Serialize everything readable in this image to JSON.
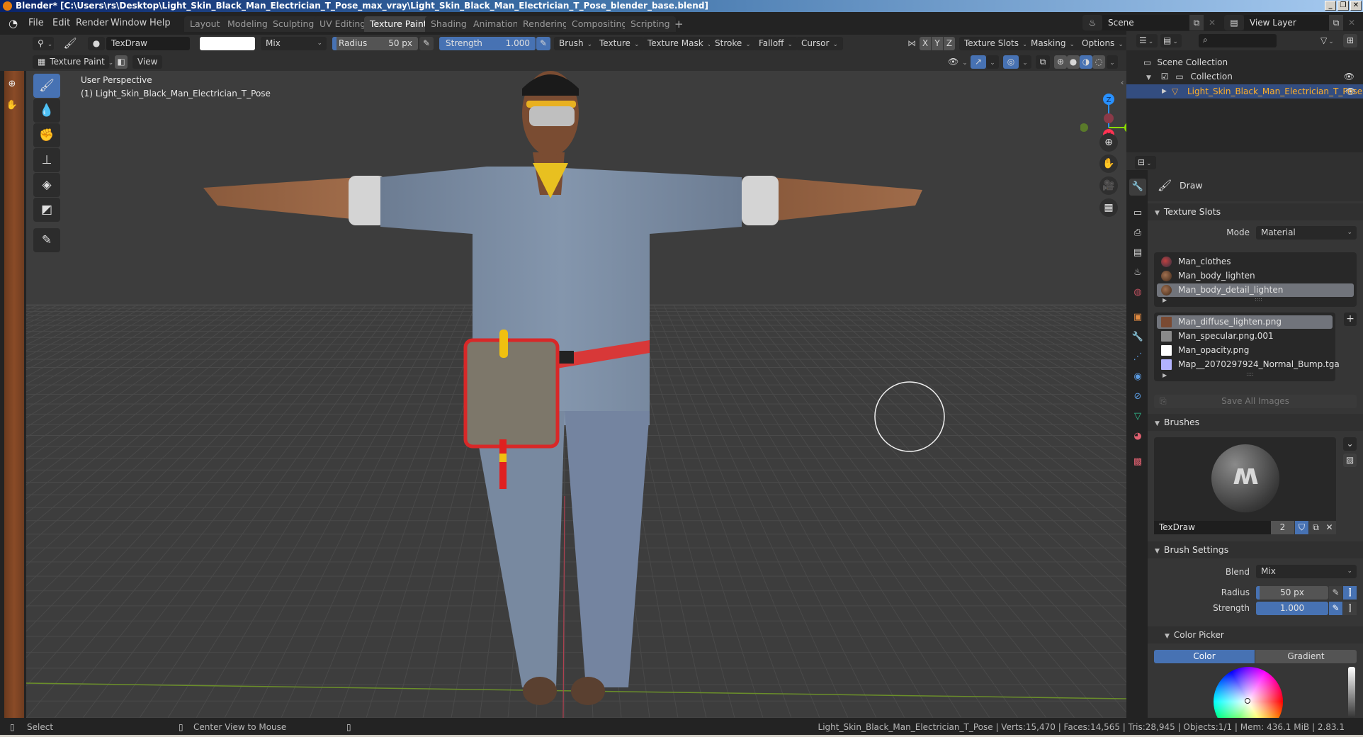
{
  "window": {
    "title": "Blender* [C:\\Users\\rs\\Desktop\\Light_Skin_Black_Man_Electrician_T_Pose_max_vray\\Light_Skin_Black_Man_Electrician_T_Pose_blender_base.blend]",
    "controls": [
      "_",
      "❐",
      "✕"
    ]
  },
  "menu": [
    "File",
    "Edit",
    "Render",
    "Window",
    "Help"
  ],
  "workspaces": [
    {
      "label": "Layout",
      "active": false
    },
    {
      "label": "Modeling",
      "active": false
    },
    {
      "label": "Sculpting",
      "active": false
    },
    {
      "label": "UV Editing",
      "active": false
    },
    {
      "label": "Texture Paint",
      "active": true
    },
    {
      "label": "Shading",
      "active": false
    },
    {
      "label": "Animation",
      "active": false
    },
    {
      "label": "Rendering",
      "active": false
    },
    {
      "label": "Compositing",
      "active": false
    },
    {
      "label": "Scripting",
      "active": false
    }
  ],
  "add_workspace": "+",
  "scene": {
    "label": "Scene",
    "view_layer": "View Layer"
  },
  "tool_header": {
    "brush_name": "TexDraw",
    "color_hex": "#ffffff",
    "blend": "Mix",
    "radius_label": "Radius",
    "radius_value": "50 px",
    "radius_fraction": 0.05,
    "strength_label": "Strength",
    "strength_value": "1.000",
    "strength_fraction": 1.0,
    "menus": [
      "Brush",
      "Texture",
      "Texture Mask",
      "Stroke",
      "Falloff",
      "Cursor"
    ],
    "axes": [
      "X",
      "Y",
      "Z"
    ],
    "right_menus": [
      "Texture Slots",
      "Masking",
      "Options"
    ]
  },
  "mode_header": {
    "mode": "Texture Paint",
    "view": "View"
  },
  "viewport": {
    "perspective": "User Perspective",
    "object": "(1) Light_Skin_Black_Man_Electrician_T_Pose",
    "gizmo": {
      "z": "Z",
      "y": "Y",
      "x": "X"
    },
    "axis_colors": {
      "x": "#ff3352",
      "y": "#8bdc00",
      "z": "#2890ff"
    }
  },
  "tools": [
    "draw",
    "soften",
    "smear",
    "clone",
    "fill",
    "mask",
    "annotate"
  ],
  "outliner": {
    "search_placeholder": "",
    "items": [
      {
        "label": "Scene Collection",
        "level": 0
      },
      {
        "label": "Collection",
        "level": 1,
        "checked": true
      },
      {
        "label": "Light_Skin_Black_Man_Electrician_T_Pose",
        "level": 2,
        "selected": true
      }
    ]
  },
  "properties": {
    "tool_name": "Draw",
    "texture_slots": {
      "title": "Texture Slots",
      "mode_label": "Mode",
      "mode_value": "Material",
      "materials": [
        {
          "label": "Man_clothes",
          "selected": false
        },
        {
          "label": "Man_body_lighten",
          "selected": false
        },
        {
          "label": "Man_body_detail_lighten",
          "selected": true
        }
      ],
      "images": [
        {
          "label": "Man_diffuse_lighten.png",
          "selected": true,
          "swatch": "#7a4a32"
        },
        {
          "label": "Man_specular.png.001",
          "selected": false,
          "swatch": "#8a8a8a"
        },
        {
          "label": "Man_opacity.png",
          "selected": false,
          "swatch": "#ffffff"
        },
        {
          "label": "Map__2070297924_Normal_Bump.tga",
          "selected": false,
          "swatch": "#b3b3ff"
        }
      ],
      "save_all": "Save All Images"
    },
    "brushes": {
      "title": "Brushes",
      "brush_name": "TexDraw",
      "users": "2"
    },
    "brush_settings": {
      "title": "Brush Settings",
      "blend_label": "Blend",
      "blend_value": "Mix",
      "radius_label": "Radius",
      "radius_value": "50 px",
      "radius_fraction": 0.05,
      "strength_label": "Strength",
      "strength_value": "1.000",
      "strength_fraction": 1.0
    },
    "color_picker": {
      "title": "Color Picker",
      "tabs": [
        {
          "label": "Color",
          "active": true
        },
        {
          "label": "Gradient",
          "active": false
        }
      ]
    }
  },
  "status": {
    "left": [
      {
        "label": "Select",
        "icon": "mouse-left-icon"
      },
      {
        "label": "Center View to Mouse",
        "icon": "mouse-middle-icon"
      },
      {
        "label": "",
        "icon": "mouse-right-icon"
      }
    ],
    "right": "Light_Skin_Black_Man_Electrician_T_Pose | Verts:15,470 | Faces:14,565 | Tris:28,945 | Objects:1/1 | Mem: 436.1 MiB | 2.83.1"
  }
}
